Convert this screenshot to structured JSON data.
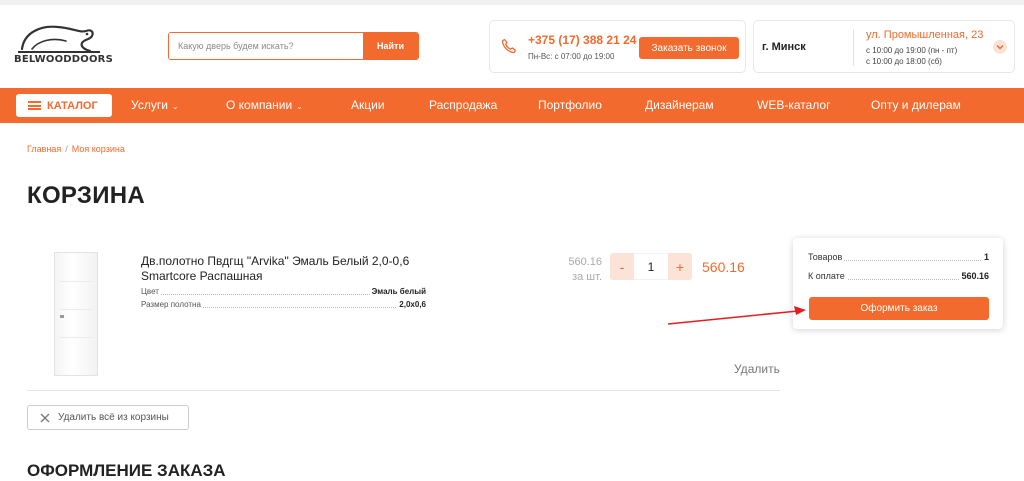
{
  "header": {
    "logo_text": "BELWOODDOORS",
    "search": {
      "placeholder": "Какую дверь будем искать?",
      "button_label": "Найти"
    },
    "phone": {
      "number": "+375 (17) 388 21 24",
      "hours": "Пн-Вс: с 07:00 до 19:00",
      "callback_label": "Заказать звонок"
    },
    "location": {
      "city": "г. Минск",
      "address": "ул. Промышленная, 23",
      "schedule_weekdays": "с 10:00 до 19:00 (пн - пт)",
      "schedule_saturday": "с 10:00 до 18:00 (сб)"
    }
  },
  "nav": {
    "catalog_label": "КАТАЛОГ",
    "items": [
      {
        "label": "Услуги",
        "dropdown": "⌄"
      },
      {
        "label": "О компании",
        "dropdown": "⌄"
      },
      {
        "label": "Акции"
      },
      {
        "label": "Распродажа"
      },
      {
        "label": "Портфолио"
      },
      {
        "label": "Дизайнерам"
      },
      {
        "label": "WEB-каталог"
      },
      {
        "label": "Опту и дилерам"
      }
    ]
  },
  "breadcrumbs": {
    "home": "Главная",
    "separator": "/",
    "current": "Моя корзина"
  },
  "page_title": "КОРЗИНА",
  "cart": {
    "item": {
      "name": "Дв.полотно Пвдгщ \"Arvika\" Эмаль Белый 2,0-0,6 Smartcore Распашная",
      "props": [
        {
          "label": "Цвет",
          "value": "Эмаль белый"
        },
        {
          "label": "Размер полотна",
          "value": "2,0х0,6"
        }
      ],
      "unit_price": "560.16",
      "unit_label": "за шт.",
      "qty": "1",
      "minus_label": "-",
      "plus_label": "+",
      "total": "560.16",
      "delete_label": "Удалить"
    },
    "clear_label": "Удалить всё из корзины"
  },
  "summary": {
    "items_label": "Товаров",
    "items_count": "1",
    "pay_label": "К оплате",
    "pay_total": "560.16",
    "order_button": "Оформить заказ"
  },
  "section_heading": "ОФОРМЛЕНИЕ ЗАКАЗА",
  "colors": {
    "accent": "#f26a2e",
    "accent_light": "#fbe3d7",
    "annotation_arrow": "#e02020"
  }
}
